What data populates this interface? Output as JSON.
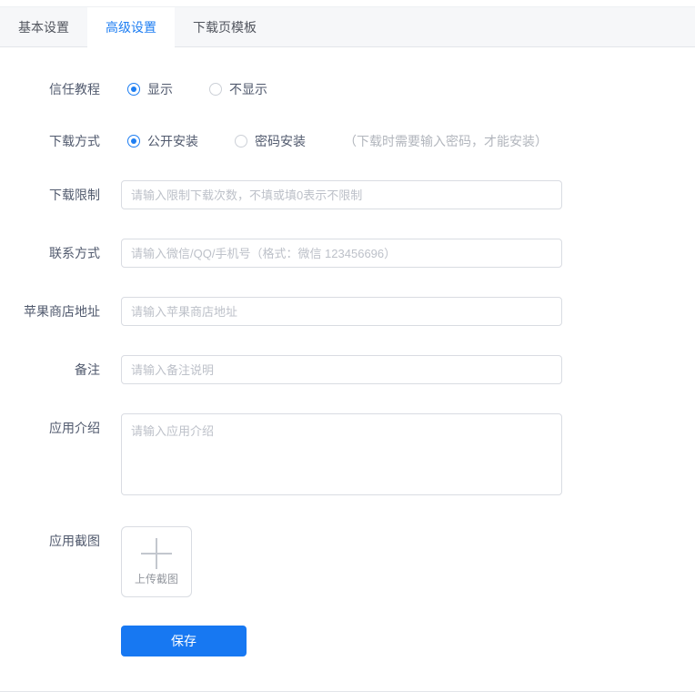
{
  "colors": {
    "primary": "#1778f2",
    "tab_active_text": "#1e7ef2",
    "tabbar_bg": "#f6f7f9",
    "input_border": "#d9dce2",
    "placeholder": "#bdc1c9"
  },
  "tabs": [
    {
      "label": "基本设置",
      "active": false
    },
    {
      "label": "高级设置",
      "active": true
    },
    {
      "label": "下载页模板",
      "active": false
    }
  ],
  "form": {
    "trust_tutorial": {
      "label": "信任教程",
      "options": [
        {
          "label": "显示",
          "selected": true
        },
        {
          "label": "不显示",
          "selected": false
        }
      ]
    },
    "download_method": {
      "label": "下载方式",
      "options": [
        {
          "label": "公开安装",
          "selected": true
        },
        {
          "label": "密码安装",
          "selected": false
        }
      ],
      "password_hint": "（下载时需要输入密码，才能安装）"
    },
    "download_limit": {
      "label": "下载限制",
      "value": "",
      "placeholder": "请输入限制下载次数，不填或填0表示不限制"
    },
    "contact": {
      "label": "联系方式",
      "value": "",
      "placeholder": "请输入微信/QQ/手机号（格式：微信 123456696）"
    },
    "appstore_url": {
      "label": "苹果商店地址",
      "value": "",
      "placeholder": "请输入苹果商店地址"
    },
    "remark": {
      "label": "备注",
      "value": "",
      "placeholder": "请输入备注说明"
    },
    "app_intro": {
      "label": "应用介绍",
      "value": "",
      "placeholder": "请输入应用介绍"
    },
    "app_screenshot": {
      "label": "应用截图",
      "upload_text": "上传截图"
    },
    "save_label": "保存"
  }
}
